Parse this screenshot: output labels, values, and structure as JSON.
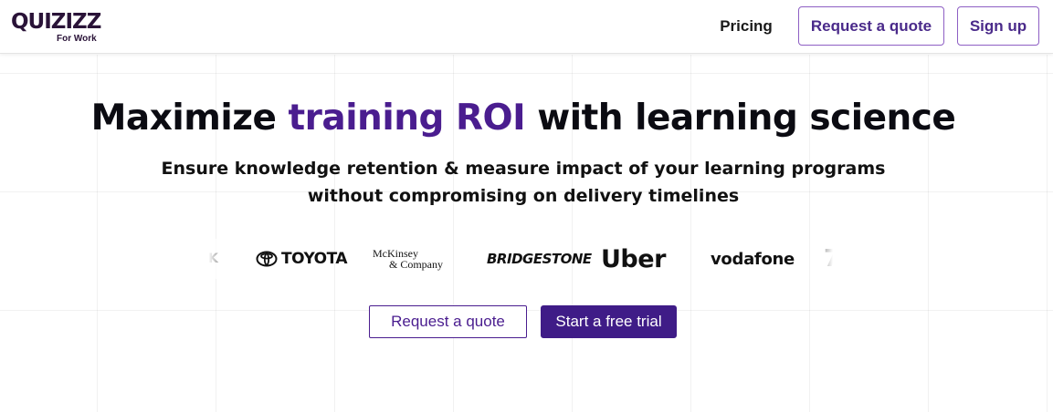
{
  "header": {
    "logo_text": "QUIZIZZ",
    "logo_sub": "For Work",
    "nav_pricing": "Pricing",
    "request_quote": "Request a quote",
    "sign_up": "Sign up"
  },
  "hero": {
    "title_pre": "Maximize ",
    "title_accent": "training ROI",
    "title_post": " with learning science",
    "subtitle_line1": "Ensure knowledge retention & measure impact of your learning programs",
    "subtitle_line2": "without compromising on delivery timelines"
  },
  "logos": {
    "partial_left": "K",
    "toyota": "TOYOTA",
    "mckinsey_line1": "McKinsey",
    "mckinsey_line2": "& Company",
    "bridgestone": "BRIDGESTONE",
    "uber": "Uber",
    "vodafone": "vodafone",
    "partial_right": "7"
  },
  "cta": {
    "request_quote": "Request a quote",
    "start_trial": "Start a free trial"
  },
  "colors": {
    "accent": "#4a1d8f",
    "primary_button": "#3f1c87",
    "outline_border": "#8e5fc4"
  }
}
